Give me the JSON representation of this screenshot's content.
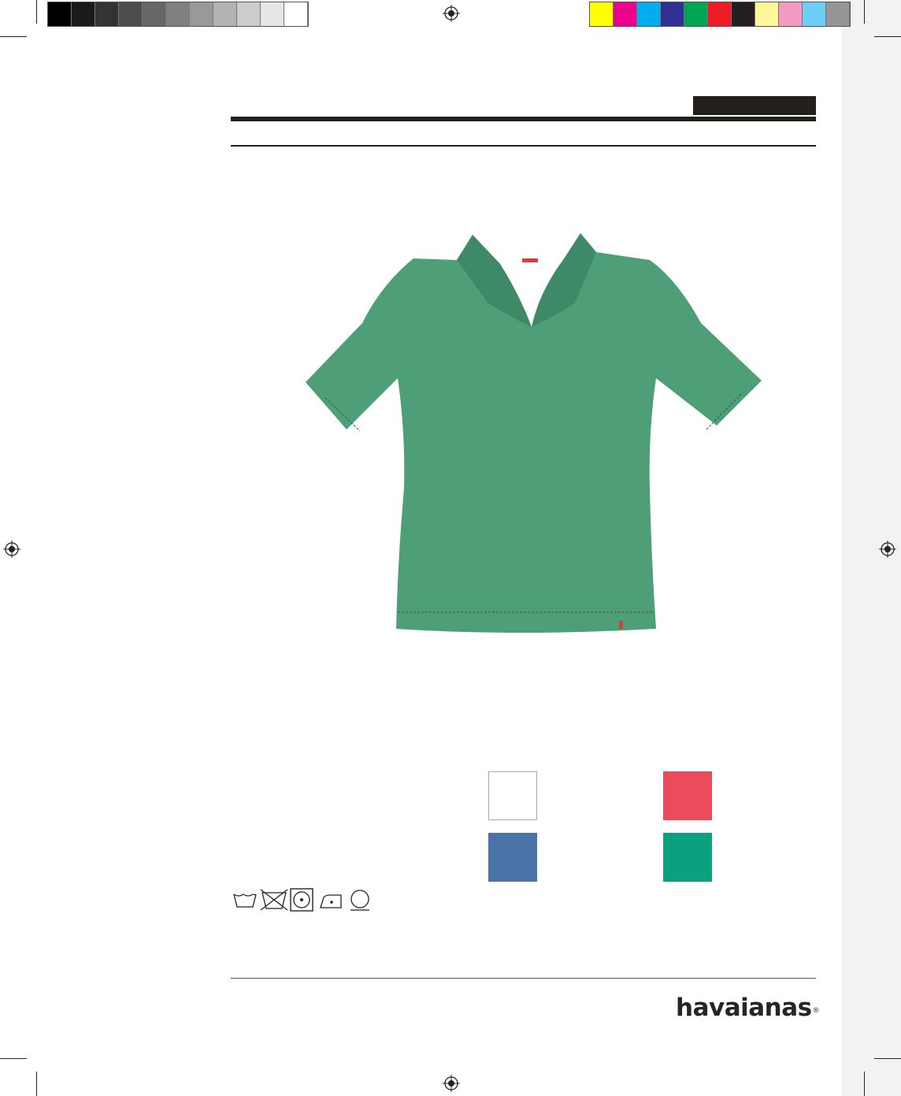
{
  "calibration": {
    "grayscale": [
      "#000000",
      "#1a1a1a",
      "#333333",
      "#4d4d4d",
      "#666666",
      "#808080",
      "#999999",
      "#b3b3b3",
      "#cccccc",
      "#e6e6e6",
      "#ffffff"
    ],
    "process_colors": [
      "#ffff00",
      "#ec008c",
      "#00aeef",
      "#2e3192",
      "#00a651",
      "#ed1c24",
      "#231f20",
      "#fff799",
      "#f49ac1",
      "#6dcff6",
      "#959595"
    ]
  },
  "product": {
    "garment_color": "#4e9e78",
    "color_swatches": [
      {
        "name": "white",
        "hex": "#ffffff"
      },
      {
        "name": "coral",
        "hex": "#ec4b5c"
      },
      {
        "name": "blue",
        "hex": "#4a74a8"
      },
      {
        "name": "green",
        "hex": "#0ba07e"
      }
    ],
    "care_icons": [
      "wash-30-icon",
      "no-tumble-dry-icon",
      "dryer-icon",
      "iron-low-icon",
      "dry-clean-icon"
    ]
  },
  "brand": {
    "name": "havaianas",
    "mark": "®"
  }
}
